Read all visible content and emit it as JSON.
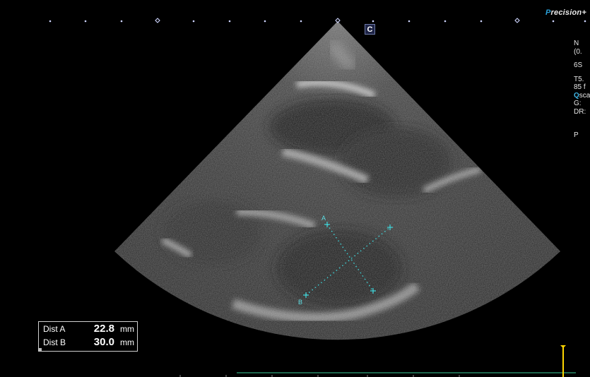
{
  "brand": {
    "prefix": "P",
    "rest": "recision",
    "suffix": "+"
  },
  "params": {
    "line1": "N",
    "line2": "(0.",
    "line3": "6S",
    "line4": "T5.",
    "line5": "85 f",
    "line6_q": "Q",
    "line6_rest": "sca",
    "line7": "G:",
    "line8": "DR:",
    "line9": "P"
  },
  "center_marker": "C",
  "calipers": {
    "a_label": "A",
    "b_label": "B"
  },
  "measurements": {
    "rows": [
      {
        "label": "Dist A",
        "value": "22.8",
        "unit": "mm"
      },
      {
        "label": "Dist B",
        "value": "30.0",
        "unit": "mm"
      }
    ]
  },
  "colors": {
    "caliper": "#3fd7dc",
    "marker_accent": "#2aa0d8",
    "cursor": "#ffd600",
    "timeline": "#2fa37a"
  }
}
